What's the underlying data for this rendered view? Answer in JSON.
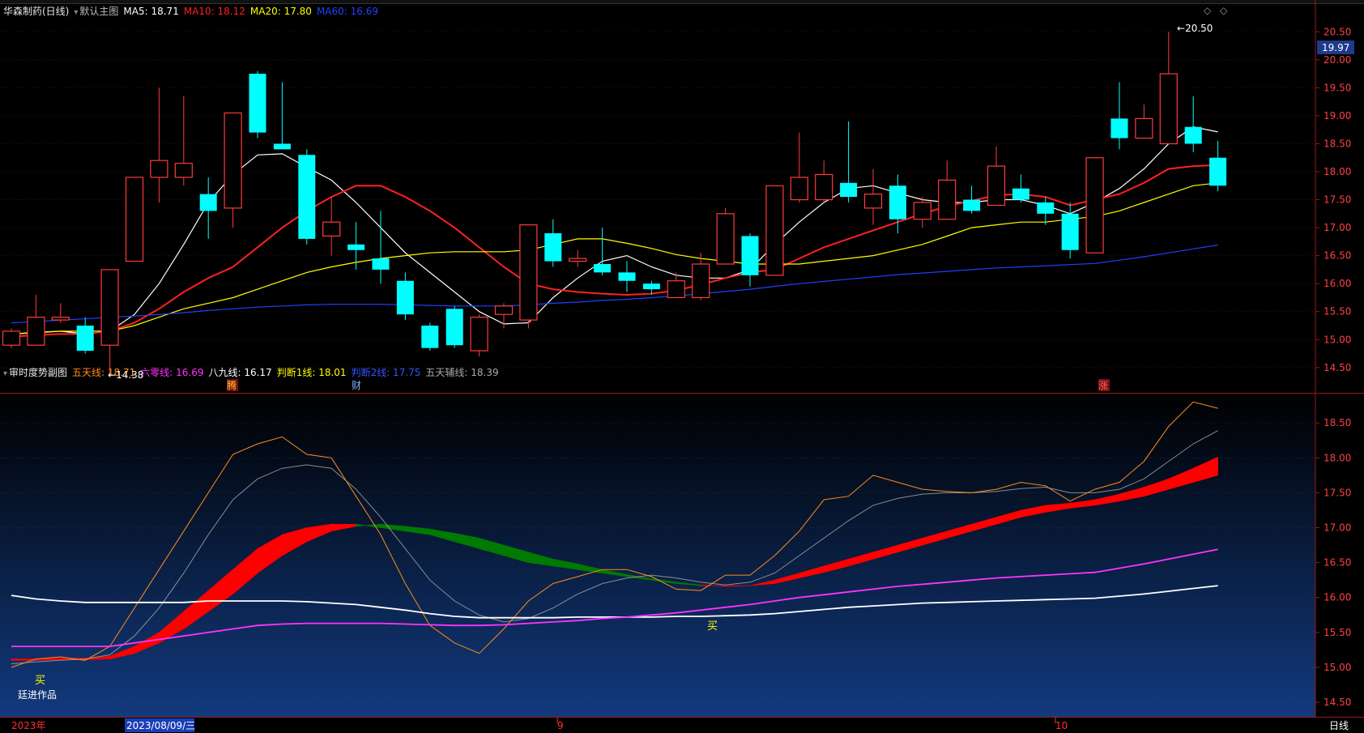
{
  "main_header": {
    "stock": "华森制药(日线)",
    "template": "默认主图",
    "ma": [
      {
        "label": "MA5: 18.71",
        "color": "#ffffff"
      },
      {
        "label": "MA10: 18.12",
        "color": "#ff2020"
      },
      {
        "label": "MA20: 17.80",
        "color": "#ffff00"
      },
      {
        "label": "MA60: 16.69",
        "color": "#2040ff"
      }
    ],
    "price_tag": "19.97",
    "high_label": "20.50",
    "low_label": "14.38"
  },
  "sub_header": {
    "name": "审时度势副图",
    "items": [
      {
        "label": "五天线: 18.71",
        "color": "#ff8c1a"
      },
      {
        "label": "六零线: 16.69",
        "color": "#ff33ff"
      },
      {
        "label": "八九线: 16.17",
        "color": "#ffffff"
      },
      {
        "label": "判断1线: 18.01",
        "color": "#ffff00"
      },
      {
        "label": "判断2线: 17.75",
        "color": "#3355ff"
      },
      {
        "label": "五天辅线: 18.39",
        "color": "#aaaaaa"
      }
    ],
    "buy_marker": "买",
    "author": "廷进作品"
  },
  "event_markers": [
    "腾",
    "财",
    "涨"
  ],
  "timeline": {
    "year": "2023年",
    "cursor_date": "2023/08/09/三",
    "month_marks": [
      "9",
      "10"
    ],
    "period": "日线"
  },
  "chart_data": [
    {
      "type": "candlestick",
      "title": "华森制药(日线)",
      "ylim": [
        14.15,
        20.75
      ],
      "yticks": [
        14.5,
        15.0,
        15.5,
        16.0,
        16.5,
        17.0,
        17.5,
        18.0,
        18.5,
        19.0,
        19.5,
        20.0,
        20.5
      ],
      "candles": [
        {
          "o": 14.9,
          "h": 15.2,
          "l": 14.85,
          "c": 15.15
        },
        {
          "o": 14.9,
          "h": 15.8,
          "l": 14.9,
          "c": 15.4
        },
        {
          "o": 15.35,
          "h": 15.65,
          "l": 15.3,
          "c": 15.4
        },
        {
          "o": 15.25,
          "h": 15.4,
          "l": 14.75,
          "c": 14.8
        },
        {
          "o": 14.9,
          "h": 16.25,
          "l": 14.38,
          "c": 16.25
        },
        {
          "o": 16.4,
          "h": 17.9,
          "l": 16.4,
          "c": 17.9
        },
        {
          "o": 17.9,
          "h": 19.5,
          "l": 17.45,
          "c": 18.2
        },
        {
          "o": 17.9,
          "h": 19.35,
          "l": 17.75,
          "c": 18.15
        },
        {
          "o": 17.6,
          "h": 17.9,
          "l": 16.8,
          "c": 17.3
        },
        {
          "o": 17.35,
          "h": 19.05,
          "l": 17.0,
          "c": 19.05
        },
        {
          "o": 19.75,
          "h": 19.8,
          "l": 18.6,
          "c": 18.7
        },
        {
          "o": 18.5,
          "h": 19.6,
          "l": 18.4,
          "c": 18.4
        },
        {
          "o": 18.3,
          "h": 18.4,
          "l": 16.7,
          "c": 16.8
        },
        {
          "o": 16.85,
          "h": 17.55,
          "l": 16.5,
          "c": 17.1
        },
        {
          "o": 16.7,
          "h": 17.1,
          "l": 16.25,
          "c": 16.6
        },
        {
          "o": 16.45,
          "h": 17.3,
          "l": 16.0,
          "c": 16.25
        },
        {
          "o": 16.05,
          "h": 16.2,
          "l": 15.35,
          "c": 15.45
        },
        {
          "o": 15.25,
          "h": 15.3,
          "l": 14.8,
          "c": 14.85
        },
        {
          "o": 15.55,
          "h": 15.6,
          "l": 14.85,
          "c": 14.9
        },
        {
          "o": 14.8,
          "h": 15.45,
          "l": 14.7,
          "c": 15.4
        },
        {
          "o": 15.45,
          "h": 15.65,
          "l": 15.2,
          "c": 15.6
        },
        {
          "o": 15.35,
          "h": 17.05,
          "l": 15.2,
          "c": 17.05
        },
        {
          "o": 16.9,
          "h": 17.15,
          "l": 16.3,
          "c": 16.4
        },
        {
          "o": 16.4,
          "h": 16.6,
          "l": 16.3,
          "c": 16.45
        },
        {
          "o": 16.35,
          "h": 17.0,
          "l": 16.15,
          "c": 16.2
        },
        {
          "o": 16.2,
          "h": 16.4,
          "l": 15.85,
          "c": 16.05
        },
        {
          "o": 16.0,
          "h": 16.05,
          "l": 15.8,
          "c": 15.9
        },
        {
          "o": 15.75,
          "h": 16.2,
          "l": 15.75,
          "c": 16.05
        },
        {
          "o": 15.75,
          "h": 16.55,
          "l": 15.7,
          "c": 16.35
        },
        {
          "o": 16.35,
          "h": 17.35,
          "l": 16.35,
          "c": 17.25
        },
        {
          "o": 16.85,
          "h": 16.9,
          "l": 15.95,
          "c": 16.15
        },
        {
          "o": 16.15,
          "h": 17.75,
          "l": 16.15,
          "c": 17.75
        },
        {
          "o": 17.5,
          "h": 18.7,
          "l": 17.45,
          "c": 17.9
        },
        {
          "o": 17.5,
          "h": 18.2,
          "l": 17.45,
          "c": 17.95
        },
        {
          "o": 17.8,
          "h": 18.9,
          "l": 17.45,
          "c": 17.55
        },
        {
          "o": 17.35,
          "h": 18.05,
          "l": 17.05,
          "c": 17.6
        },
        {
          "o": 17.75,
          "h": 17.95,
          "l": 16.9,
          "c": 17.15
        },
        {
          "o": 17.15,
          "h": 17.55,
          "l": 17.0,
          "c": 17.45
        },
        {
          "o": 17.15,
          "h": 18.2,
          "l": 17.15,
          "c": 17.85
        },
        {
          "o": 17.5,
          "h": 17.75,
          "l": 17.25,
          "c": 17.3
        },
        {
          "o": 17.4,
          "h": 18.45,
          "l": 17.4,
          "c": 18.1
        },
        {
          "o": 17.7,
          "h": 17.95,
          "l": 17.45,
          "c": 17.5
        },
        {
          "o": 17.45,
          "h": 17.55,
          "l": 17.05,
          "c": 17.25
        },
        {
          "o": 17.25,
          "h": 17.45,
          "l": 16.45,
          "c": 16.6
        },
        {
          "o": 16.55,
          "h": 18.25,
          "l": 16.55,
          "c": 18.25
        },
        {
          "o": 18.95,
          "h": 19.6,
          "l": 18.4,
          "c": 18.6
        },
        {
          "o": 18.6,
          "h": 19.2,
          "l": 18.6,
          "c": 18.95
        },
        {
          "o": 18.5,
          "h": 20.5,
          "l": 18.5,
          "c": 19.75
        },
        {
          "o": 18.8,
          "h": 19.35,
          "l": 18.35,
          "c": 18.5
        },
        {
          "o": 18.25,
          "h": 18.55,
          "l": 17.65,
          "c": 17.75
        }
      ],
      "ma": [
        {
          "name": "MA5",
          "color": "#ffffff",
          "values": [
            15.1,
            15.13,
            15.15,
            15.1,
            15.15,
            15.45,
            16.0,
            16.7,
            17.45,
            17.95,
            18.3,
            18.32,
            18.08,
            17.85,
            17.45,
            17.0,
            16.55,
            16.2,
            15.85,
            15.5,
            15.28,
            15.3,
            15.75,
            16.1,
            16.4,
            16.5,
            16.3,
            16.15,
            16.1,
            16.1,
            16.25,
            16.7,
            17.1,
            17.45,
            17.7,
            17.75,
            17.62,
            17.5,
            17.45,
            17.45,
            17.5,
            17.5,
            17.4,
            17.25,
            17.45,
            17.7,
            18.05,
            18.5,
            18.8,
            18.71
          ]
        },
        {
          "name": "MA10",
          "color": "#ff2020",
          "values": [
            15.05,
            15.08,
            15.1,
            15.1,
            15.15,
            15.3,
            15.55,
            15.85,
            16.1,
            16.3,
            16.65,
            17.0,
            17.3,
            17.55,
            17.75,
            17.75,
            17.55,
            17.3,
            17.0,
            16.65,
            16.3,
            16.0,
            15.9,
            15.85,
            15.82,
            15.8,
            15.82,
            15.88,
            15.98,
            16.1,
            16.2,
            16.25,
            16.45,
            16.65,
            16.8,
            16.95,
            17.1,
            17.25,
            17.38,
            17.48,
            17.58,
            17.6,
            17.55,
            17.4,
            17.5,
            17.6,
            17.8,
            18.05,
            18.1,
            18.12
          ]
        },
        {
          "name": "MA20",
          "color": "#ffff00",
          "values": [
            15.1,
            15.12,
            15.15,
            15.15,
            15.15,
            15.25,
            15.4,
            15.55,
            15.65,
            15.75,
            15.9,
            16.05,
            16.2,
            16.3,
            16.38,
            16.45,
            16.5,
            16.55,
            16.57,
            16.57,
            16.57,
            16.6,
            16.7,
            16.8,
            16.8,
            16.72,
            16.63,
            16.52,
            16.45,
            16.4,
            16.35,
            16.35,
            16.35,
            16.4,
            16.45,
            16.5,
            16.6,
            16.7,
            16.85,
            17.0,
            17.05,
            17.1,
            17.1,
            17.15,
            17.2,
            17.3,
            17.45,
            17.6,
            17.75,
            17.8
          ]
        },
        {
          "name": "MA60",
          "color": "#2040ff",
          "values": [
            15.3,
            15.32,
            15.35,
            15.37,
            15.4,
            15.42,
            15.45,
            15.48,
            15.52,
            15.55,
            15.58,
            15.6,
            15.62,
            15.63,
            15.63,
            15.63,
            15.62,
            15.61,
            15.6,
            15.6,
            15.6,
            15.62,
            15.65,
            15.67,
            15.7,
            15.72,
            15.75,
            15.78,
            15.82,
            15.86,
            15.9,
            15.95,
            16.0,
            16.04,
            16.08,
            16.12,
            16.16,
            16.19,
            16.22,
            16.25,
            16.28,
            16.3,
            16.32,
            16.34,
            16.36,
            16.42,
            16.48,
            16.55,
            16.62,
            16.69
          ]
        }
      ]
    },
    {
      "type": "line",
      "title": "审时度势副图",
      "ylim": [
        14.35,
        18.85
      ],
      "yticks": [
        14.5,
        15.0,
        15.5,
        16.0,
        16.5,
        17.0,
        17.5,
        18.0,
        18.5
      ],
      "series": [
        {
          "name": "五天线",
          "color": "#ff8c1a",
          "values": [
            15.0,
            15.12,
            15.15,
            15.1,
            15.3,
            15.85,
            16.4,
            16.95,
            17.5,
            18.05,
            18.2,
            18.3,
            18.05,
            18.0,
            17.45,
            16.9,
            16.2,
            15.6,
            15.35,
            15.2,
            15.55,
            15.95,
            16.2,
            16.3,
            16.4,
            16.4,
            16.3,
            16.12,
            16.1,
            16.32,
            16.32,
            16.6,
            16.95,
            17.4,
            17.45,
            17.75,
            17.65,
            17.55,
            17.52,
            17.5,
            17.55,
            17.65,
            17.6,
            17.38,
            17.55,
            17.65,
            17.95,
            18.45,
            18.8,
            18.71
          ]
        },
        {
          "name": "五天辅线",
          "color": "#aaaaaa",
          "values": [
            15.05,
            15.08,
            15.1,
            15.12,
            15.18,
            15.45,
            15.85,
            16.35,
            16.9,
            17.4,
            17.7,
            17.85,
            17.9,
            17.85,
            17.55,
            17.15,
            16.7,
            16.25,
            15.95,
            15.75,
            15.65,
            15.7,
            15.85,
            16.05,
            16.2,
            16.28,
            16.32,
            16.28,
            16.22,
            16.18,
            16.22,
            16.35,
            16.6,
            16.85,
            17.1,
            17.32,
            17.42,
            17.48,
            17.5,
            17.5,
            17.52,
            17.56,
            17.58,
            17.5,
            17.5,
            17.55,
            17.7,
            17.95,
            18.2,
            18.39
          ]
        },
        {
          "name": "八九线",
          "color": "#ffffff",
          "values": [
            16.03,
            15.98,
            15.95,
            15.93,
            15.93,
            15.93,
            15.93,
            15.93,
            15.95,
            15.95,
            15.95,
            15.95,
            15.94,
            15.92,
            15.9,
            15.86,
            15.82,
            15.77,
            15.73,
            15.71,
            15.71,
            15.71,
            15.71,
            15.72,
            15.72,
            15.72,
            15.72,
            15.73,
            15.73,
            15.74,
            15.75,
            15.77,
            15.8,
            15.83,
            15.86,
            15.88,
            15.9,
            15.92,
            15.93,
            15.94,
            15.95,
            15.96,
            15.97,
            15.98,
            15.99,
            16.02,
            16.05,
            16.09,
            16.13,
            16.17
          ]
        },
        {
          "name": "六零线",
          "color": "#ff33ff",
          "values": [
            15.3,
            15.3,
            15.3,
            15.3,
            15.3,
            15.35,
            15.4,
            15.45,
            15.5,
            15.55,
            15.6,
            15.62,
            15.63,
            15.63,
            15.63,
            15.63,
            15.62,
            15.61,
            15.6,
            15.6,
            15.61,
            15.63,
            15.65,
            15.67,
            15.7,
            15.72,
            15.75,
            15.78,
            15.82,
            15.86,
            15.9,
            15.95,
            16.0,
            16.04,
            16.08,
            16.12,
            16.16,
            16.19,
            16.22,
            16.25,
            16.28,
            16.3,
            16.32,
            16.34,
            16.36,
            16.42,
            16.48,
            16.55,
            16.62,
            16.69
          ]
        },
        {
          "name": "判断1线",
          "color": "#ffff00",
          "values": [
            15.12,
            15.12,
            15.13,
            15.13,
            15.16,
            15.3,
            15.5,
            15.8,
            16.1,
            16.4,
            16.7,
            16.9,
            17.0,
            17.05,
            17.05,
            17.0,
            16.95,
            16.9,
            16.8,
            16.7,
            16.6,
            16.5,
            16.45,
            16.4,
            16.35,
            16.3,
            16.25,
            16.2,
            16.17,
            16.17,
            16.17,
            16.25,
            16.35,
            16.45,
            16.55,
            16.65,
            16.75,
            16.85,
            16.95,
            17.05,
            17.15,
            17.25,
            17.32,
            17.35,
            17.4,
            17.48,
            17.58,
            17.7,
            17.85,
            18.01
          ]
        },
        {
          "name": "判断2线",
          "color": "#3355ff",
          "values": [
            15.1,
            15.1,
            15.11,
            15.11,
            15.12,
            15.2,
            15.35,
            15.55,
            15.8,
            16.05,
            16.35,
            16.6,
            16.8,
            16.95,
            17.02,
            17.05,
            17.02,
            16.98,
            16.92,
            16.85,
            16.75,
            16.65,
            16.55,
            16.48,
            16.4,
            16.33,
            16.27,
            16.22,
            16.18,
            16.16,
            16.17,
            16.2,
            16.28,
            16.36,
            16.45,
            16.55,
            16.65,
            16.75,
            16.85,
            16.95,
            17.05,
            17.15,
            17.22,
            17.28,
            17.32,
            17.38,
            17.45,
            17.55,
            17.65,
            17.75
          ]
        }
      ]
    }
  ]
}
